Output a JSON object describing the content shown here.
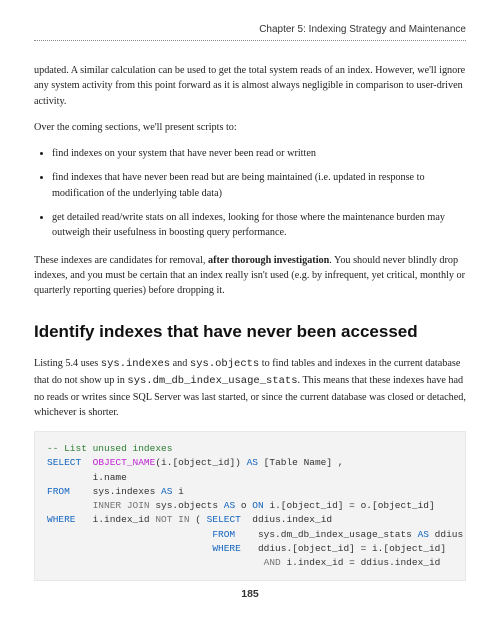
{
  "header": {
    "chapter": "Chapter 5: Indexing Strategy and Maintenance"
  },
  "p1": "updated. A similar calculation can be used to get the total system reads of an index. However, we'll ignore any system activity from this point forward as it is almost always negligible in comparison to user-driven activity.",
  "p2": "Over the coming sections, we'll present scripts to:",
  "bullets": [
    "find indexes on your system that have never been read or written",
    "find indexes that have never been read but are being maintained (i.e. updated in response to modification of the underlying table data)",
    "get detailed read/write stats on all indexes, looking for those where the maintenance burden may outweigh their usefulness in boosting query performance."
  ],
  "p3a": "These indexes are candidates for removal, ",
  "p3bold": "after thorough investigation",
  "p3b": ". You should never blindly drop indexes, and you must be certain that an index really isn't used (e.g. by infrequent, yet critical, monthly or quarterly reporting queries) before dropping it.",
  "heading": "Identify indexes that have never been accessed",
  "p4a": "Listing 5.4 uses ",
  "p4code1": "sys.indexes",
  "p4b": " and ",
  "p4code2": "sys.objects",
  "p4c": " to find tables and indexes in the current database that do not show up in ",
  "p4code3": "sys.dm_db_index_usage_stats",
  "p4d": ". This means that these indexes have had no reads or writes since SQL Server was last started, or since the current database was closed or detached, whichever is shorter.",
  "code": {
    "l1": "-- List unused indexes",
    "l2kw": "SELECT",
    "l2func": "OBJECT_NAME",
    "l2rest": "(i.[object_id])",
    "l2as": "AS",
    "l2rest2": " [Table Name] ,",
    "l3": "        i.name",
    "l4kw": "FROM",
    "l4rest": "    sys.indexes ",
    "l4as": "AS",
    "l4rest2": " i",
    "l5a": "        ",
    "l5join": "INNER JOIN",
    "l5b": " sys.objects ",
    "l5as": "AS",
    "l5c": " o ",
    "l5on": "ON",
    "l5d": " i.[object_id] = o.[object_id]",
    "l6kw": "WHERE",
    "l6a": "   i.index_id ",
    "l6not": "NOT IN",
    "l6b": " ( ",
    "l6sel": "SELECT",
    "l6c": "  ddius.index_id",
    "l7a": "                             ",
    "l7from": "FROM",
    "l7b": "    sys.dm_db_index_usage_stats ",
    "l7as": "AS",
    "l7c": " ddius",
    "l8a": "                             ",
    "l8where": "WHERE",
    "l8b": "   ddius.[object_id] = i.[object_id]",
    "l9a": "                                      ",
    "l9and": "AND",
    "l9b": " i.index_id = ddius.index_id"
  },
  "pageNumber": "185"
}
